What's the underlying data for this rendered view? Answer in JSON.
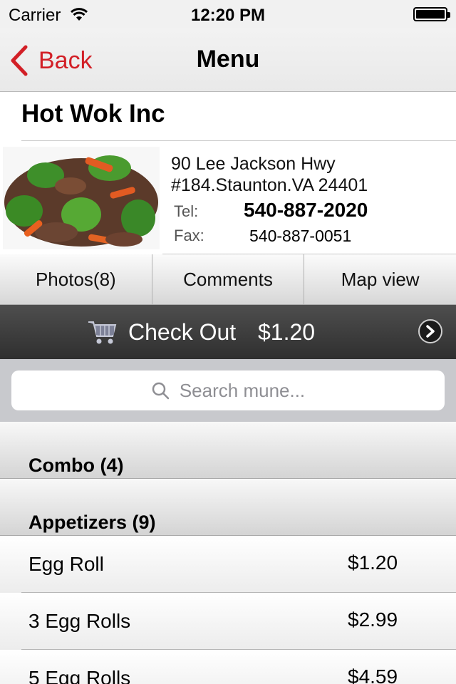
{
  "status_bar": {
    "carrier": "Carrier",
    "time": "12:20 PM"
  },
  "nav": {
    "back_label": "Back",
    "title": "Menu"
  },
  "restaurant": {
    "name": "Hot Wok Inc",
    "address_line1": "90 Lee Jackson Hwy",
    "address_line2": "#184.Staunton.VA 24401",
    "tel_label": "Tel:",
    "tel": "540-887-2020",
    "fax_label": "Fax:",
    "fax": "540-887-0051"
  },
  "tabs": [
    {
      "label": "Photos(8)"
    },
    {
      "label": "Comments"
    },
    {
      "label": "Map view"
    }
  ],
  "checkout": {
    "label": "Check Out",
    "amount": "$1.20"
  },
  "search": {
    "placeholder": "Search mune..."
  },
  "sections": [
    {
      "label": "Combo (4)"
    },
    {
      "label": "Appetizers (9)"
    }
  ],
  "items": [
    {
      "name": "Egg Roll",
      "price": "$1.20"
    },
    {
      "name": "3 Egg Rolls",
      "price": "$2.99"
    },
    {
      "name": "5 Egg Rolls",
      "price": "$4.59"
    }
  ],
  "colors": {
    "accent": "#d21f26",
    "checkout_bg": "#3c3c3c",
    "search_bg": "#c8c9cd"
  },
  "icons": [
    "wifi-icon",
    "battery-icon",
    "back-chevron-icon",
    "cart-icon",
    "chevron-right-icon",
    "search-icon"
  ]
}
